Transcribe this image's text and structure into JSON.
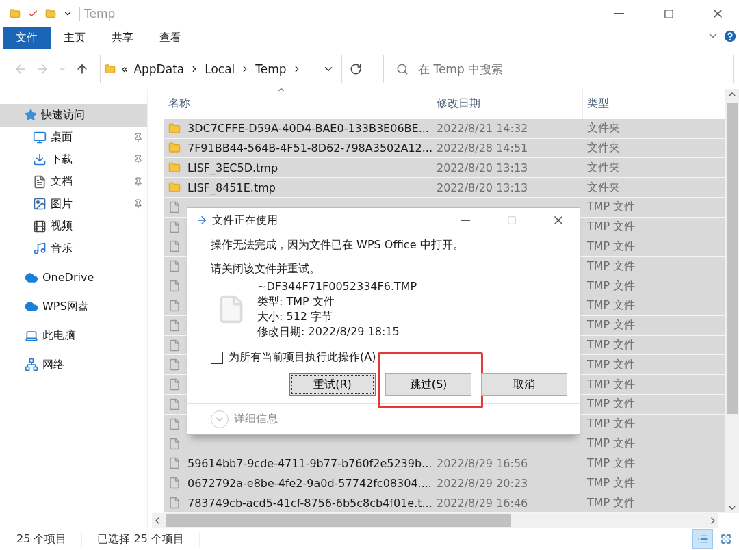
{
  "window": {
    "title": "Temp"
  },
  "ribbon": {
    "tabs": [
      {
        "label": "文件",
        "selected": true
      },
      {
        "label": "主页",
        "selected": false
      },
      {
        "label": "共享",
        "selected": false
      },
      {
        "label": "查看",
        "selected": false
      }
    ]
  },
  "address": {
    "overflow": "«",
    "path": [
      "AppData",
      "Local",
      "Temp"
    ]
  },
  "search": {
    "placeholder": "在 Temp 中搜索"
  },
  "sidebar": {
    "items": [
      {
        "label": "快速访问",
        "kind": "star",
        "selected": true,
        "children": [
          {
            "label": "桌面",
            "kind": "desktop",
            "pinned": true,
            "selected": false
          },
          {
            "label": "下载",
            "kind": "download",
            "pinned": true,
            "selected": false
          },
          {
            "label": "文档",
            "kind": "document",
            "pinned": true,
            "selected": false
          },
          {
            "label": "图片",
            "kind": "picture",
            "pinned": true,
            "selected": false
          },
          {
            "label": "视频",
            "kind": "video",
            "pinned": false,
            "selected": false
          },
          {
            "label": "音乐",
            "kind": "music",
            "pinned": false,
            "selected": false
          }
        ]
      },
      {
        "label": "OneDrive",
        "kind": "cloud",
        "selected": false
      },
      {
        "label": "WPS网盘",
        "kind": "cloud",
        "selected": false
      },
      {
        "label": "此电脑",
        "kind": "computer",
        "selected": false
      },
      {
        "label": "网络",
        "kind": "network",
        "selected": false
      }
    ]
  },
  "table": {
    "columns": [
      "名称",
      "修改日期",
      "类型"
    ],
    "rows": [
      {
        "kind": "folder",
        "selected": true,
        "name": "3DC7CFFE-D59A-40D4-BAE0-133B3E06BE...",
        "date": "2022/8/21 14:32",
        "type": "文件夹"
      },
      {
        "kind": "folder",
        "selected": true,
        "name": "7F91BB44-564B-4F51-8D62-798A3502A12...",
        "date": "2022/8/28 14:51",
        "type": "文件夹"
      },
      {
        "kind": "folder",
        "selected": true,
        "name": "LISF_3EC5D.tmp",
        "date": "2022/8/20 13:13",
        "type": "文件夹"
      },
      {
        "kind": "folder",
        "selected": true,
        "name": "LISF_8451E.tmp",
        "date": "2022/8/20 13:13",
        "type": "文件夹"
      },
      {
        "kind": "file",
        "selected": true,
        "type": "TMP 文件"
      },
      {
        "kind": "file",
        "selected": true,
        "type": "TMP 文件"
      },
      {
        "kind": "file",
        "selected": true,
        "type": "TMP 文件"
      },
      {
        "kind": "file",
        "selected": true,
        "type": "TMP 文件"
      },
      {
        "kind": "file",
        "selected": true,
        "type": "TMP 文件"
      },
      {
        "kind": "file",
        "selected": true,
        "type": "TMP 文件"
      },
      {
        "kind": "file",
        "selected": true,
        "type": "TMP 文件"
      },
      {
        "kind": "file",
        "selected": true,
        "type": "TMP 文件"
      },
      {
        "kind": "file",
        "selected": true,
        "type": "TMP 文件"
      },
      {
        "kind": "file",
        "selected": true,
        "type": "TMP 文件"
      },
      {
        "kind": "file",
        "selected": true,
        "type": "TMP 文件"
      },
      {
        "kind": "file",
        "selected": true,
        "type": "TMP 文件"
      },
      {
        "kind": "file",
        "selected": true,
        "type": "TMP 文件"
      },
      {
        "kind": "file",
        "selected": true,
        "name": "59614bb7-9cde-4711-9b77-b760f2e5239b...",
        "date": "2022/8/29 16:56",
        "type": "TMP 文件"
      },
      {
        "kind": "file",
        "selected": true,
        "name": "0672792a-e8be-4fe2-9a0d-57742fc08304....",
        "date": "2022/8/29 20:23",
        "type": "TMP 文件"
      },
      {
        "kind": "file",
        "selected": true,
        "name": "783749cb-acd5-41cf-8756-6b5c8cb4f01e.t...",
        "date": "2022/8/29 16:46",
        "type": "TMP 文件"
      }
    ]
  },
  "status_bar": {
    "count": "25 个项目",
    "selection": "已选择 25 个项目"
  },
  "dialog": {
    "title": "文件正在使用",
    "message": "操作无法完成，因为文件已在 WPS Office 中打开。",
    "hint": "请关闭该文件并重试。",
    "file": {
      "name": "~DF344F71F0052334F6.TMP",
      "type": "类型: TMP 文件",
      "size": "大小: 512 字节",
      "modified": "修改日期: 2022/8/29 18:15"
    },
    "apply_all": {
      "label": "为所有当前项目执行此操作(A)",
      "checked": false
    },
    "buttons": [
      {
        "label": "重试(R)",
        "focused": true,
        "highlighted": false
      },
      {
        "label": "跳过(S)",
        "focused": false,
        "highlighted": true
      },
      {
        "label": "取消",
        "focused": false,
        "highlighted": false
      }
    ],
    "details": "详细信息"
  }
}
